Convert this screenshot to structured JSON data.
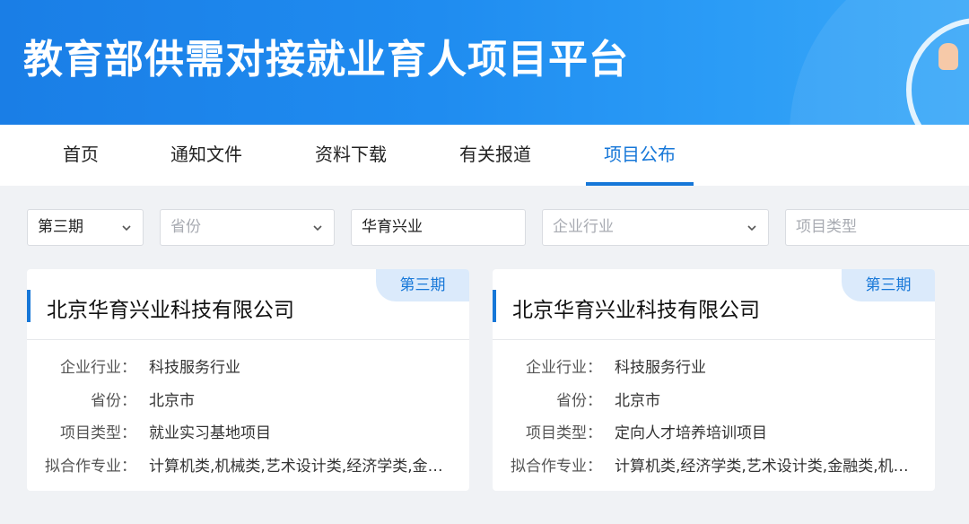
{
  "header": {
    "title": "教育部供需对接就业育人项目平台"
  },
  "nav": {
    "items": [
      {
        "label": "首页"
      },
      {
        "label": "通知文件"
      },
      {
        "label": "资料下载"
      },
      {
        "label": "有关报道"
      },
      {
        "label": "项目公布"
      }
    ],
    "active": "项目公布"
  },
  "filters": {
    "batch": "第三期",
    "province_placeholder": "省份",
    "keyword": "华育兴业",
    "industry_placeholder": "企业行业",
    "type_placeholder": "项目类型"
  },
  "labels": {
    "industry": "企业行业：",
    "province": "省份：",
    "type": "项目类型：",
    "majors": "拟合作专业："
  },
  "cards": [
    {
      "badge": "第三期",
      "name": "北京华育兴业科技有限公司",
      "industry": "科技服务行业",
      "province": "北京市",
      "type": "就业实习基地项目",
      "majors": "计算机类,机械类,艺术设计类,经济学类,金融类"
    },
    {
      "badge": "第三期",
      "name": "北京华育兴业科技有限公司",
      "industry": "科技服务行业",
      "province": "北京市",
      "type": "定向人才培养培训项目",
      "majors": "计算机类,经济学类,艺术设计类,金融类,机械类"
    }
  ],
  "colors": {
    "accent": "#1677d8",
    "banner": "#1f8cf0",
    "badge_bg": "#dbeafb"
  }
}
